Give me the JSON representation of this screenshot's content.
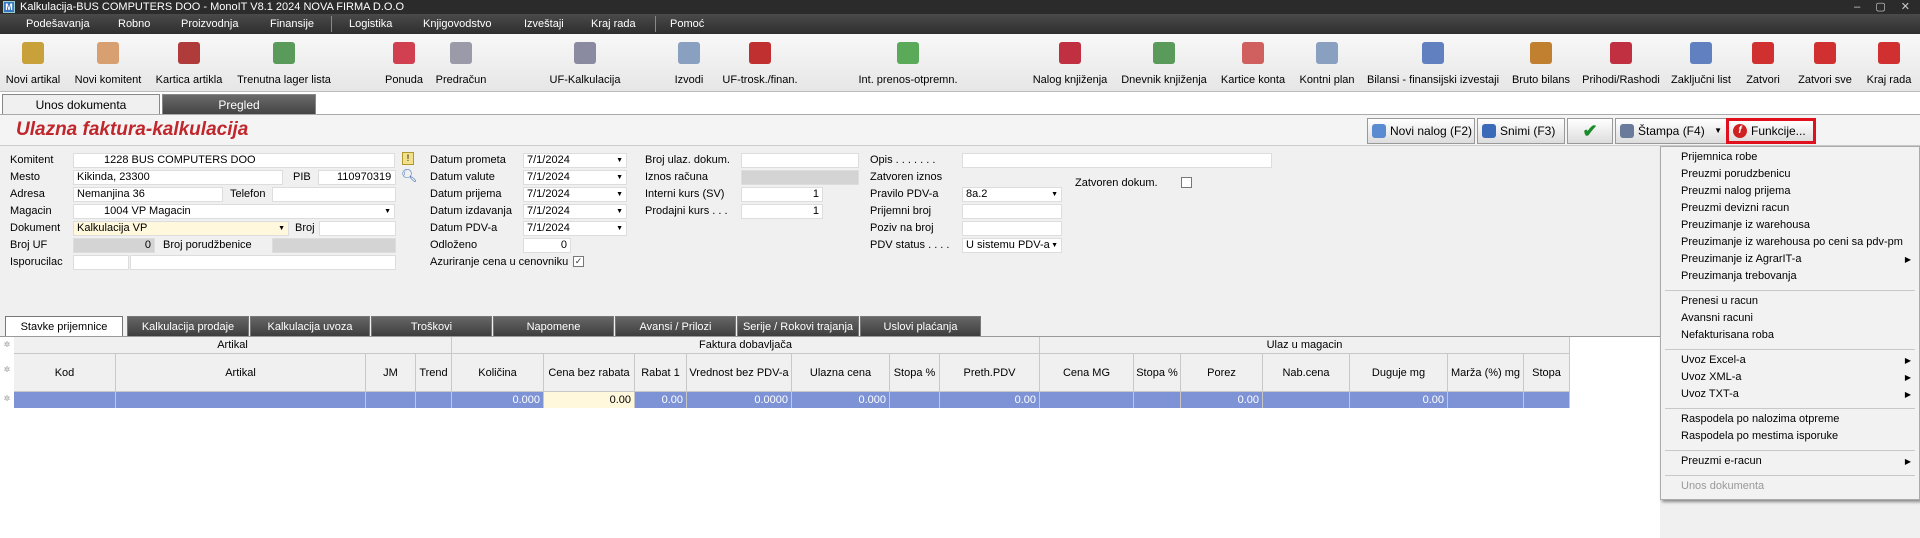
{
  "window": {
    "title": "Kalkulacija-BUS COMPUTERS DOO - MonoIT V8.1 2024 NOVA FIRMA D.O.O"
  },
  "menu": [
    "Podešavanja",
    "Robno",
    "Proizvodnja",
    "Finansije",
    "Logistika",
    "Knjigovodstvo",
    "Izveštaji",
    "Kraj rada",
    "Pomoć"
  ],
  "toolbar": [
    {
      "label": "Novi artikal",
      "icon": "new-article-icon",
      "color": "#c9a13a"
    },
    {
      "label": "Novi komitent",
      "icon": "new-client-icon",
      "color": "#d8a070"
    },
    {
      "label": "Kartica artikla",
      "icon": "article-card-icon",
      "color": "#b03b3b"
    },
    {
      "label": "Trenutna lager lista",
      "icon": "stock-list-icon",
      "color": "#5a9a5a"
    },
    {
      "label": "Ponuda",
      "icon": "offer-icon",
      "color": "#d04050"
    },
    {
      "label": "Predračun",
      "icon": "proforma-icon",
      "color": "#9a9aa8"
    },
    {
      "label": "UF-Kalkulacija",
      "icon": "calculation-icon",
      "color": "#8a8aa0"
    },
    {
      "label": "Izvodi",
      "icon": "statements-icon",
      "color": "#8aa0c0"
    },
    {
      "label": "UF-trosk./finan.",
      "icon": "costs-icon",
      "color": "#c03030"
    },
    {
      "label": "Int. prenos-otpremn.",
      "icon": "transfer-icon",
      "color": "#5aaa5a"
    },
    {
      "label": "Nalog knjiženja",
      "icon": "posting-order-icon",
      "color": "#c03040"
    },
    {
      "label": "Dnevnik knjiženja",
      "icon": "journal-icon",
      "color": "#5a9a5a"
    },
    {
      "label": "Kartice konta",
      "icon": "account-cards-icon",
      "color": "#d06060"
    },
    {
      "label": "Kontni plan",
      "icon": "chart-of-accounts-icon",
      "color": "#8aa0c0"
    },
    {
      "label": "Bilansi - finansijski izvestaji",
      "icon": "balance-icon",
      "color": "#6080c0"
    },
    {
      "label": "Bruto bilans",
      "icon": "gross-balance-icon",
      "color": "#c08030"
    },
    {
      "label": "Prihodi/Rashodi",
      "icon": "income-expense-icon",
      "color": "#c03040"
    },
    {
      "label": "Zaključni list",
      "icon": "closing-sheet-icon",
      "color": "#6080c0"
    },
    {
      "label": "Zatvori",
      "icon": "close-icon",
      "color": "#d03030"
    },
    {
      "label": "Zatvori sve",
      "icon": "close-all-icon",
      "color": "#d03030"
    },
    {
      "label": "Kraj rada",
      "icon": "power-icon",
      "color": "#d03030"
    }
  ],
  "tabs": {
    "entry": "Unos dokumenta",
    "review": "Pregled"
  },
  "header": {
    "title": "Ulazna faktura-kalkulacija",
    "new_order": "Novi nalog (F2)",
    "save": "Snimi (F3)",
    "print": "Štampa (F4)",
    "functions": "Funkcije..."
  },
  "form": {
    "komitent_label": "Komitent",
    "komitent": "1228 BUS COMPUTERS DOO",
    "mesto_label": "Mesto",
    "mesto": "Kikinda, 23300",
    "pib_label": "PIB",
    "pib": "110970319",
    "adresa_label": "Adresa",
    "adresa": "Nemanjina 36",
    "telefon_label": "Telefon",
    "telefon": "",
    "magacin_label": "Magacin",
    "magacin": "1004 VP Magacin",
    "dokument_label": "Dokument",
    "dokument": "Kalkulacija VP",
    "broj_label": "Broj",
    "broj": "",
    "broj_uf_label": "Broj UF",
    "broj_uf": "0",
    "broj_porudzbenice_label": "Broj porudžbenice",
    "isporucilac_label": "Isporucilac",
    "datum_prometa_label": "Datum prometa",
    "datum_prometa": "7/1/2024",
    "datum_valute_label": "Datum valute",
    "datum_valute": "7/1/2024",
    "datum_prijema_label": "Datum prijema",
    "datum_prijema": "7/1/2024",
    "datum_izdavanja_label": "Datum izdavanja",
    "datum_izdavanja": "7/1/2024",
    "datum_pdv_label": "Datum PDV-a",
    "datum_pdv": "7/1/2024",
    "odlozeno_label": "Odloženo",
    "odlozeno": "0",
    "azuriranje_label": "Azuriranje cena u cenovniku",
    "broj_ulaz_label": "Broj ulaz. dokum.",
    "iznos_racuna_label": "Iznos računa",
    "interni_kurs_label": "Interni kurs (SV)",
    "interni_kurs": "1",
    "prodajni_kurs_label": "Prodajni kurs . . .",
    "prodajni_kurs": "1",
    "opis_label": "Opis . . . . . . .",
    "zatvoren_iznos_label": "Zatvoren iznos",
    "zatvoren_dokum_label": "Zatvoren dokum.",
    "pravilo_pdv_label": "Pravilo PDV-a",
    "pravilo_pdv": "8a.2",
    "prijemni_broj_label": "Prijemni broj",
    "poziv_label": "Poziv na broj",
    "pdv_status_label": "PDV status . . . .",
    "pdv_status": "U sistemu PDV-a"
  },
  "subtabs": [
    "Stavke prijemnice",
    "Kalkulacija prodaje",
    "Kalkulacija uvoza",
    "Troškovi",
    "Napomene",
    "Avansi / Prilozi",
    "Serije / Rokovi trajanja",
    "Uslovi plaćanja"
  ],
  "grid": {
    "groups": [
      "Artikal",
      "Faktura dobavljača",
      "Ulaz u magacin"
    ],
    "columns": [
      "Kod",
      "Artikal",
      "JM",
      "Trend",
      "Količina",
      "Cena bez rabata",
      "Rabat 1",
      "Vrednost bez PDV-a",
      "Ulazna cena",
      "Stopa %",
      "Preth.PDV",
      "Cena MG",
      "Stopa %",
      "Porez",
      "Nab.cena",
      "Duguje mg",
      "Marža (%) mg",
      "Stopa"
    ],
    "row": [
      "",
      "",
      "",
      "",
      "0.000",
      "0.00",
      "0.00",
      "0.0000",
      "0.000",
      "",
      "0.00",
      "",
      "",
      "0.00",
      "",
      "0.00",
      "",
      ""
    ]
  },
  "context_menu": [
    {
      "label": "Prijemnica robe"
    },
    {
      "label": "Preuzmi porudzbenicu"
    },
    {
      "label": "Preuzmi nalog prijema"
    },
    {
      "label": "Preuzmi devizni racun"
    },
    {
      "label": "Preuzimanje iz warehousa"
    },
    {
      "label": "Preuzimanje iz warehousa po ceni sa pdv-pm"
    },
    {
      "label": "Preuzimanje iz AgrarIT-a",
      "sub": true
    },
    {
      "label": "Preuzimanja trebovanja"
    },
    {
      "sep": true
    },
    {
      "label": "Prenesi u racun"
    },
    {
      "label": "Avansni racuni"
    },
    {
      "label": "Nefakturisana roba"
    },
    {
      "sep": true
    },
    {
      "label": "Uvoz Excel-a",
      "sub": true
    },
    {
      "label": "Uvoz XML-a",
      "sub": true
    },
    {
      "label": "Uvoz TXT-a",
      "sub": true
    },
    {
      "sep": true
    },
    {
      "label": "Raspodela po nalozima otpreme"
    },
    {
      "label": "Raspodela po mestima isporuke"
    },
    {
      "sep": true
    },
    {
      "label": "Preuzmi e-racun",
      "sub": true
    },
    {
      "sep": true
    },
    {
      "label": "Unos dokumenta",
      "disabled": true
    }
  ],
  "colors": {
    "title_red": "#c0272d",
    "selection_blue": "#7d93d6",
    "highlight_border": "#e0101c"
  }
}
